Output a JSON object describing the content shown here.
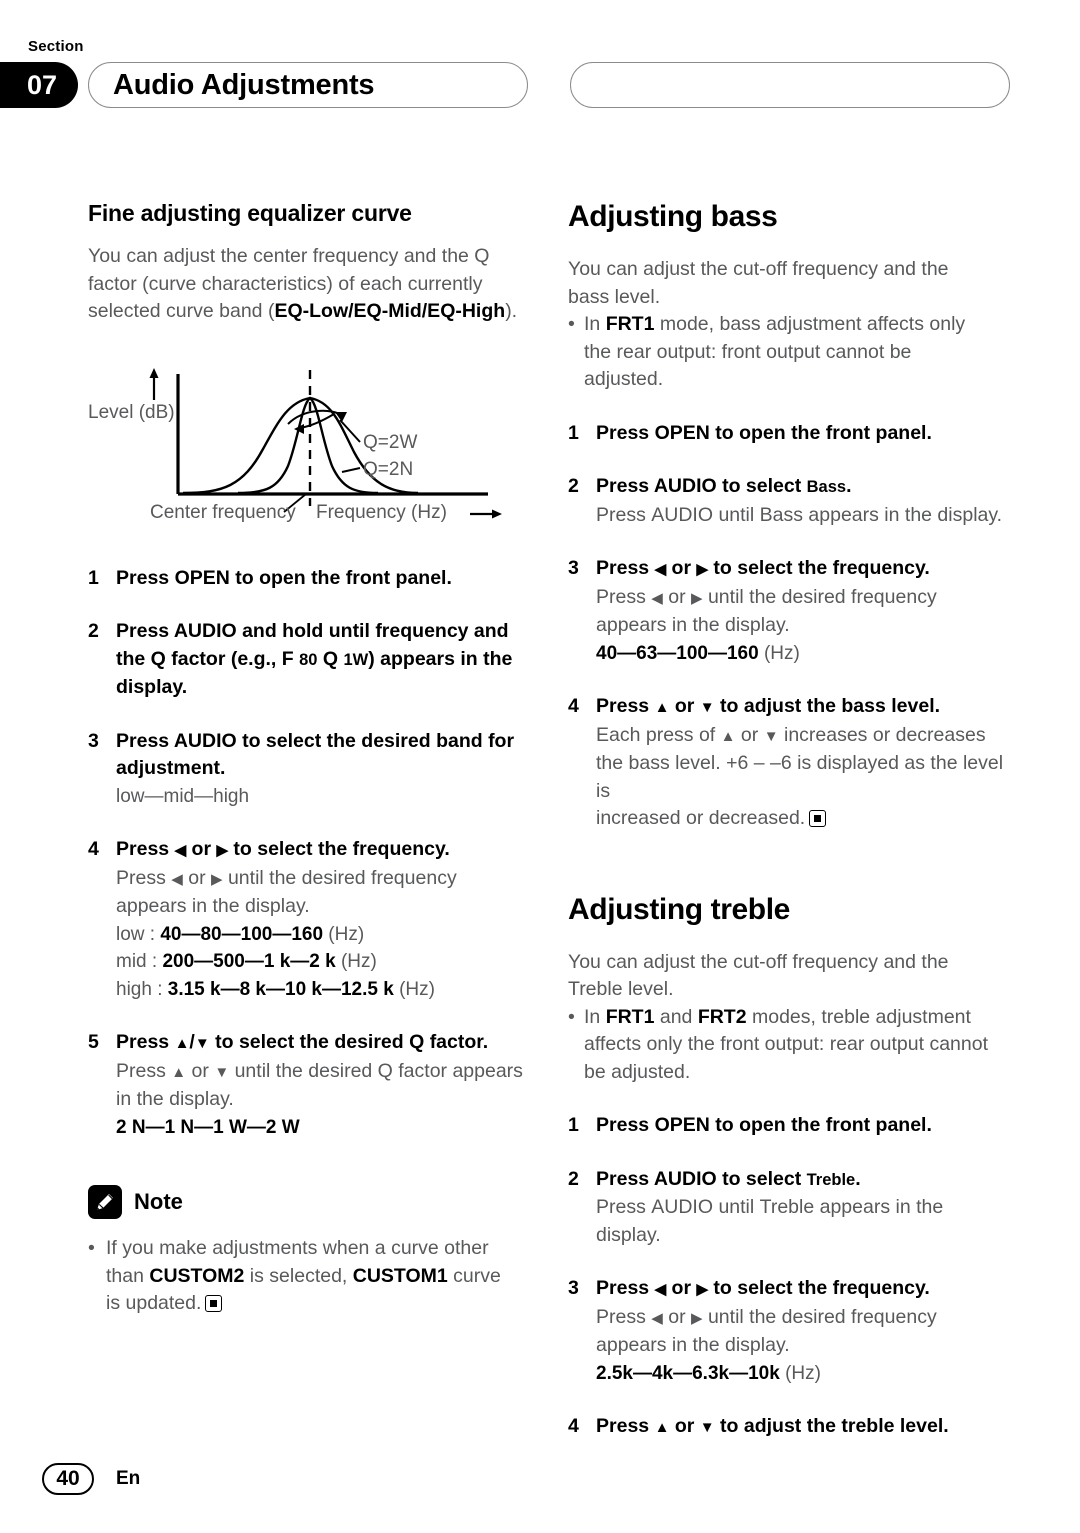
{
  "header": {
    "section_word": "Section",
    "section_number": "07",
    "title": "Audio Adjustments"
  },
  "left_column": {
    "heading": "Fine adjusting equalizer curve",
    "intro_1": "You can adjust the center frequency and the Q",
    "intro_2": "factor (curve characteristics) of each currently",
    "intro_3_pre": "selected curve band (",
    "intro_3_bold": "EQ-Low/EQ-Mid/EQ-High",
    "intro_3_post": ").",
    "diagram": {
      "y_axis_label": "Level (dB)",
      "x_axis_label": "Frequency (Hz)",
      "center_label": "Center frequency",
      "curve_wide_label": "Q=2W",
      "curve_narrow_label": "Q=2N"
    },
    "steps": [
      {
        "num": "1",
        "text_pre": "Press ",
        "text_key": "OPEN",
        "text_post": " to open the front panel."
      },
      {
        "num": "2",
        "line1_pre": "Press ",
        "line1_key": "AUDIO",
        "line1_post": " and hold until frequency and",
        "line2_pre": "the Q factor (e.g., F ",
        "line2_small1": "80",
        "line2_mid": " Q ",
        "line2_small2": "1W",
        "line2_post": ") appears in the",
        "line3": "display."
      },
      {
        "num": "3",
        "line1_pre": "Press ",
        "line1_key": "AUDIO",
        "line1_post": " to select the desired band for",
        "line2": "adjustment.",
        "values": "low—mid—high"
      },
      {
        "num": "4",
        "title_pre": "Press ",
        "title_left_arrow": "◀",
        "title_mid": " or ",
        "title_right_arrow": "▶",
        "title_post": " to select the frequency.",
        "sub_pre": "Press ",
        "sub_mid": " or ",
        "sub_post": " until the desired frequency",
        "sub_line2": "appears in the display.",
        "freq_rows": [
          {
            "label": "low : ",
            "values": "40—80—100—160",
            "unit": " (Hz)"
          },
          {
            "label": "mid : ",
            "values": "200—500—1 k—2 k",
            "unit": " (Hz)"
          },
          {
            "label": "high : ",
            "values": "3.15 k—8 k—10 k—12.5 k",
            "unit": " (Hz)"
          }
        ]
      },
      {
        "num": "5",
        "title_pre": "Press ",
        "title_up_arrow": "▲",
        "title_slash": "/",
        "title_down_arrow": "▼",
        "title_post": " to select the desired Q factor.",
        "sub_pre": "Press ",
        "sub_mid": " or ",
        "sub_post": " until the desired Q factor appears",
        "sub_line2": "in the display.",
        "values": "2 N—1 N—1 W—2 W"
      }
    ],
    "note": {
      "label": "Note",
      "icon": "pencil-icon",
      "bullet": "•",
      "line1": "If you make adjustments when a curve other",
      "line2_pre": "than  ",
      "line2_bold1": "CUSTOM2",
      "line2_mid": " is selected, ",
      "line2_bold2": "CUSTOM1",
      "line2_post": " curve",
      "line3": "is updated."
    }
  },
  "right_column": {
    "bass": {
      "heading": "Adjusting bass",
      "intro_1": "You can adjust the cut-off frequency and the",
      "intro_2": "bass level.",
      "bullet": "•",
      "bullet_pre": "In ",
      "bullet_bold": "FRT1",
      "bullet_post": " mode, bass adjustment affects only",
      "bullet_line2": "the rear output: front output cannot be",
      "bullet_line3": "adjusted.",
      "steps": [
        {
          "num": "1",
          "text_pre": "Press ",
          "text_key": "OPEN",
          "text_post": " to open the front panel."
        },
        {
          "num": "2",
          "title_pre": "Press ",
          "title_key": "AUDIO",
          "title_mid": " to select ",
          "title_small": "Bass",
          "title_post": ".",
          "sub_pre": "Press ",
          "sub_bold1": "AUDIO",
          "sub_mid": " until ",
          "sub_bold2": "Bass",
          "sub_post": " appears in the display."
        },
        {
          "num": "3",
          "title_pre": "Press ",
          "title_left_arrow": "◀",
          "title_mid": " or ",
          "title_right_arrow": "▶",
          "title_post": " to select the frequency.",
          "sub_pre": "Press ",
          "sub_mid": " or ",
          "sub_post": " until the desired frequency",
          "sub_line2": "appears in the display.",
          "values": "40—63—100—160",
          "unit": " (Hz)"
        },
        {
          "num": "4",
          "title_pre": "Press ",
          "title_up_arrow": "▲",
          "title_mid": " or ",
          "title_down_arrow": "▼",
          "title_post": " to adjust the bass level.",
          "sub_pre": "Each press of ",
          "sub_mid": " or ",
          "sub_post": " increases or decreases",
          "sub_line2_pre": "the bass level. ",
          "sub_line2_bold": "+6 – –6",
          "sub_line2_post": " is displayed as the level is",
          "sub_line3": "increased or decreased."
        }
      ]
    },
    "treble": {
      "heading": "Adjusting treble",
      "intro_1": "You can adjust the cut-off frequency and the",
      "intro_2": "Treble level.",
      "bullet": "•",
      "bullet_pre": "In ",
      "bullet_bold1": "FRT1",
      "bullet_and": " and ",
      "bullet_bold2": "FRT2",
      "bullet_post": " modes, treble adjustment",
      "bullet_line2": "affects only the front output: rear output cannot",
      "bullet_line3": "be adjusted.",
      "steps": [
        {
          "num": "1",
          "text_pre": "Press ",
          "text_key": "OPEN",
          "text_post": " to open the front panel."
        },
        {
          "num": "2",
          "title_pre": "Press ",
          "title_key": "AUDIO",
          "title_mid": " to select ",
          "title_small": "Treble",
          "title_post": ".",
          "sub_pre": "Press ",
          "sub_bold1": "AUDIO",
          "sub_mid": " until ",
          "sub_bold2": "Treble",
          "sub_post": " appears in the display."
        },
        {
          "num": "3",
          "title_pre": "Press ",
          "title_left_arrow": "◀",
          "title_mid": " or ",
          "title_right_arrow": "▶",
          "title_post": " to select the frequency.",
          "sub_pre": "Press ",
          "sub_mid": " or ",
          "sub_post": " until the desired frequency",
          "sub_line2": "appears in the display.",
          "values": "2.5k—4k—6.3k—10k",
          "unit": " (Hz)"
        },
        {
          "num": "4",
          "title_pre": "Press ",
          "title_up_arrow": "▲",
          "title_mid": " or ",
          "title_down_arrow": "▼",
          "title_post": " to adjust the treble level."
        }
      ]
    }
  },
  "footer": {
    "page_number": "40",
    "language": "En"
  },
  "colors": {
    "body_text": "#58595b",
    "heading_text": "#000000",
    "pill_border": "#8b8b8b"
  }
}
